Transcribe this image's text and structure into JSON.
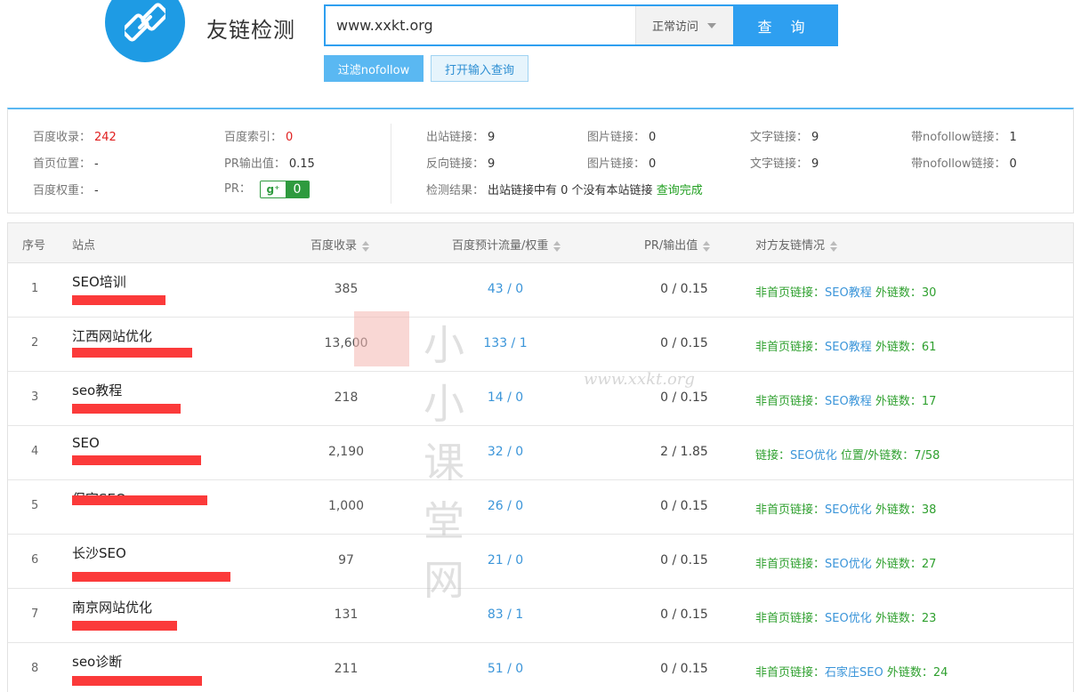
{
  "header": {
    "title": "友链检测",
    "search_value": "www.xxkt.org",
    "mode": "正常访问",
    "query_label": "查 询",
    "nofollow_label": "过滤nofollow",
    "open_query_label": "打开输入查询"
  },
  "stats": {
    "baidu_collect_label": "百度收录：",
    "baidu_collect": "242",
    "baidu_index_label": "百度索引：",
    "baidu_index": "0",
    "home_pos_label": "首页位置：",
    "home_pos": "-",
    "pr_out_label": "PR输出值：",
    "pr_out": "0.15",
    "baidu_weight_label": "百度权重：",
    "baidu_weight": "-",
    "pr_label": "PR：",
    "pr_g": "g⁺",
    "pr_value": "0",
    "out_links_label": "出站链接：",
    "out_links": "9",
    "img_links_label": "图片链接：",
    "img_links": "0",
    "text_links_label": "文字链接：",
    "text_links": "9",
    "nofollow_links_label": "带nofollow链接：",
    "nofollow_links": "1",
    "back_links_label": "反向链接：",
    "back_links": "9",
    "img_links2_label": "图片链接：",
    "img_links2": "0",
    "text_links2_label": "文字链接：",
    "text_links2": "9",
    "nofollow_links2_label": "带nofollow链接：",
    "nofollow_links2": "0",
    "result_label": "检测结果：",
    "result_text": "出站链接中有 0 个没有本站链接",
    "result_status": "查询完成"
  },
  "table": {
    "headers": [
      "序号",
      "站点",
      "百度收录",
      "百度预计流量/权重",
      "PR/输出值",
      "对方友链情况"
    ],
    "rows": [
      {
        "idx": "1",
        "name": "SEO培训",
        "collect": "385",
        "flow": "43 / 0",
        "pr": "0 / 0.15",
        "link_prefix": "非首页链接：",
        "link_anchor": "SEO教程",
        "link_suffix": " 外链数：30"
      },
      {
        "idx": "2",
        "name": "江西网站优化",
        "collect": "13,600",
        "flow": "133 / 1",
        "pr": "0 / 0.15",
        "link_prefix": "非首页链接：",
        "link_anchor": "SEO教程",
        "link_suffix": " 外链数：61"
      },
      {
        "idx": "3",
        "name": "seo教程",
        "collect": "218",
        "flow": "14 / 0",
        "pr": "0 / 0.15",
        "link_prefix": "非首页链接：",
        "link_anchor": "SEO教程",
        "link_suffix": " 外链数：17"
      },
      {
        "idx": "4",
        "name": "SEO",
        "collect": "2,190",
        "flow": "32 / 0",
        "pr": "2 / 1.85",
        "link_prefix": "链接：",
        "link_anchor": "SEO优化",
        "link_suffix": "  位置/外链数：7/58"
      },
      {
        "idx": "5",
        "name": "保定SEO",
        "collect": "1,000",
        "flow": "26 / 0",
        "pr": "0 / 0.15",
        "link_prefix": "非首页链接：",
        "link_anchor": "SEO优化",
        "link_suffix": " 外链数：38"
      },
      {
        "idx": "6",
        "name": "长沙SEO",
        "collect": "97",
        "flow": "21 / 0",
        "pr": "0 / 0.15",
        "link_prefix": "非首页链接：",
        "link_anchor": "SEO优化",
        "link_suffix": " 外链数：27"
      },
      {
        "idx": "7",
        "name": "南京网站优化",
        "collect": "131",
        "flow": "83 / 1",
        "pr": "0 / 0.15",
        "link_prefix": "非首页链接：",
        "link_anchor": "SEO优化",
        "link_suffix": " 外链数：23"
      },
      {
        "idx": "8",
        "name": "seo诊断",
        "collect": "211",
        "flow": "51 / 0",
        "pr": "0 / 0.15",
        "link_prefix": "非首页链接：",
        "link_anchor": "石家庄SEO",
        "link_suffix": " 外链数：24"
      }
    ]
  },
  "watermark": {
    "text": "小小课堂网",
    "url": "www.xxkt.org"
  },
  "colors": {
    "accent": "#2e9ff0",
    "link_green": "#2fa02f",
    "link_blue": "#3b95d9",
    "alert_red": "#e02020"
  }
}
